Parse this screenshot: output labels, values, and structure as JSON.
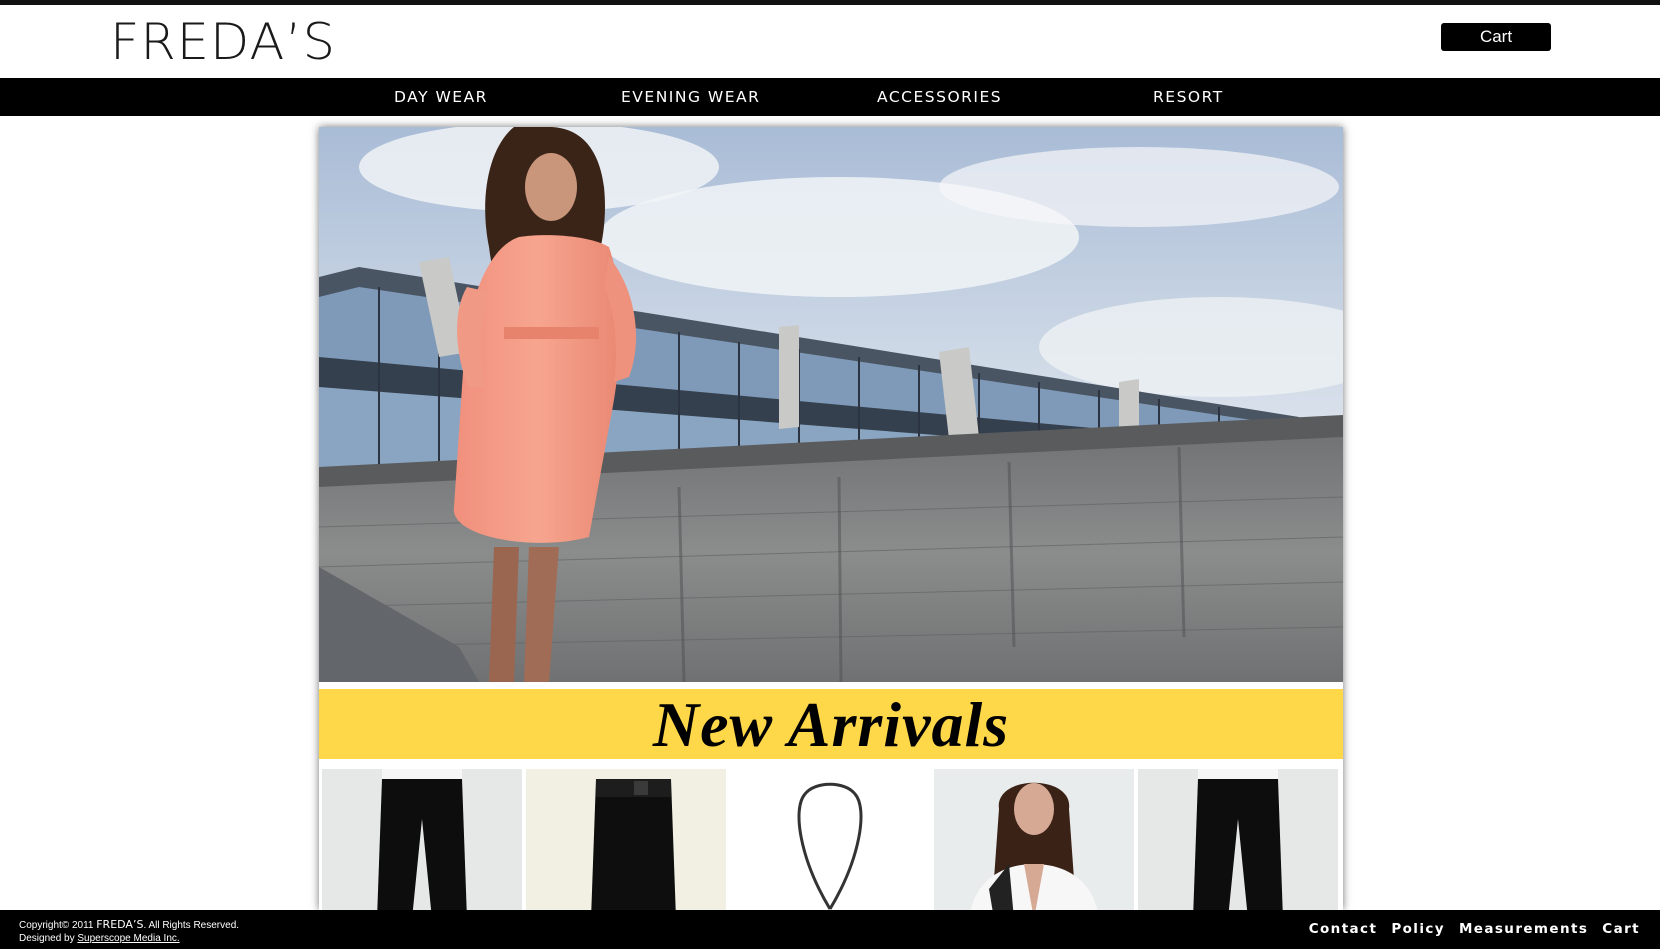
{
  "brand": {
    "logo_text": "FREDA’S"
  },
  "header": {
    "cart_label": "Cart"
  },
  "nav": {
    "items": [
      {
        "label": "DAY WEAR"
      },
      {
        "label": "EVENING WEAR"
      },
      {
        "label": "ACCESSORIES"
      },
      {
        "label": "RESORT"
      }
    ]
  },
  "banner": {
    "text": "New Arrivals"
  },
  "thumbnails": [
    {
      "icon": "black-trousers-image"
    },
    {
      "icon": "black-skirt-image"
    },
    {
      "icon": "necklace-image"
    },
    {
      "icon": "model-white-jacket-image"
    },
    {
      "icon": "black-trousers-image"
    }
  ],
  "footer": {
    "copyright_prefix": "Copyright© 2011",
    "copyright_brand": "FREDA’S",
    "copyright_suffix": ". All Rights Reserved.",
    "designed_by_prefix": "Designed by",
    "designer_link": "Superscope Media Inc.",
    "links": [
      {
        "label": "Contact"
      },
      {
        "label": "Policy"
      },
      {
        "label": "Measurements"
      },
      {
        "label": "Cart"
      }
    ]
  },
  "colors": {
    "nav_bg": "#000000",
    "banner_bg": "#ffd84a",
    "footer_bg": "#000000"
  }
}
